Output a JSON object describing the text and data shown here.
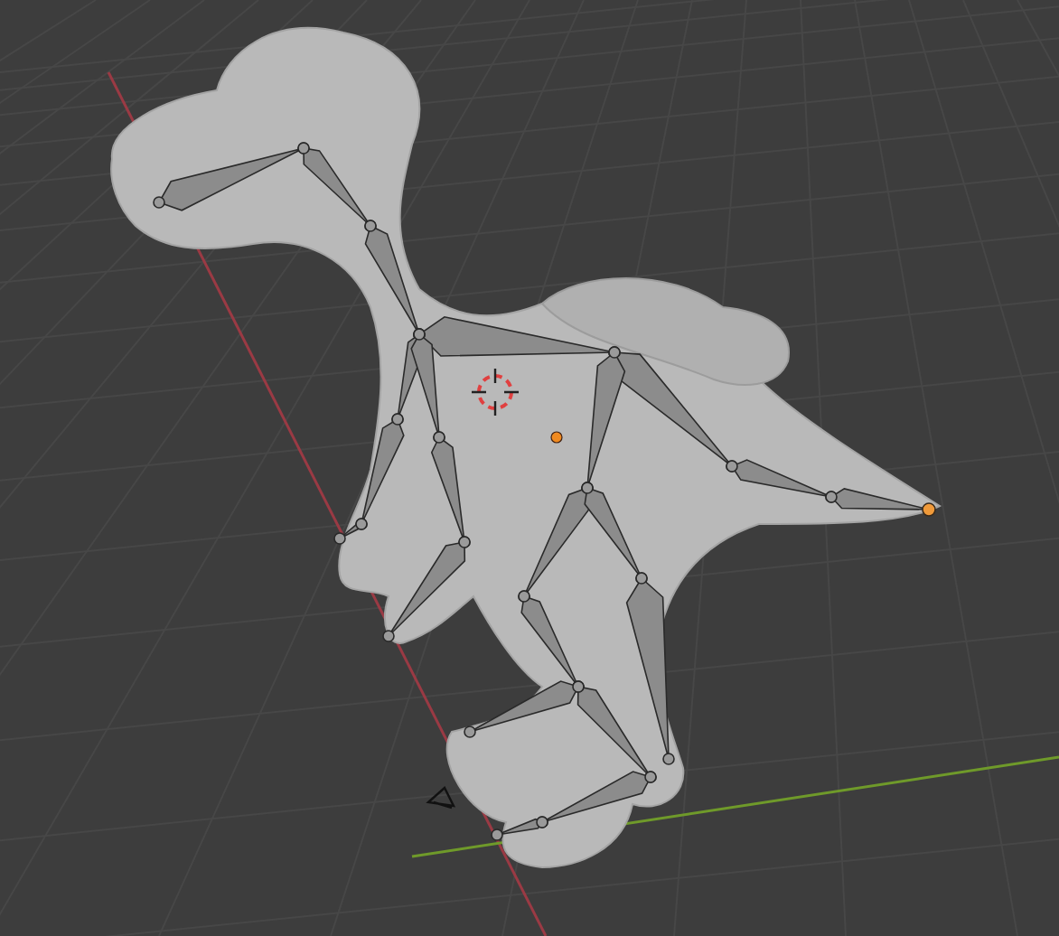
{
  "viewport": {
    "objects": [
      {
        "kind": "grid"
      },
      {
        "kind": "mesh"
      },
      {
        "kind": "armature"
      },
      {
        "kind": "cursor"
      },
      {
        "kind": "origin"
      },
      {
        "kind": "light"
      }
    ]
  }
}
